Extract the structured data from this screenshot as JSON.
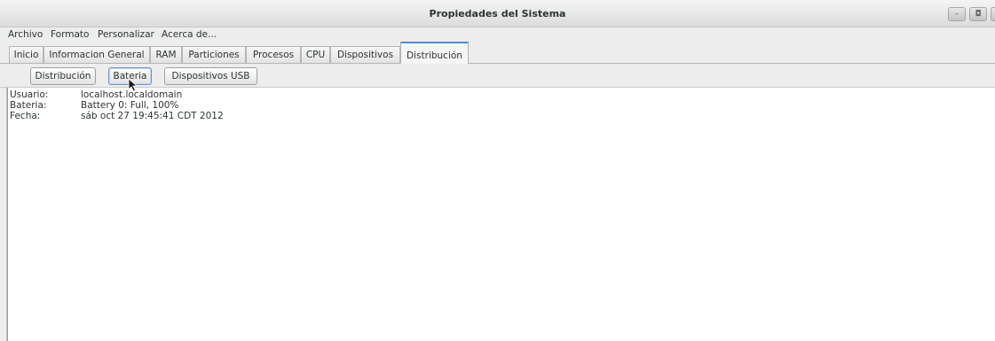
{
  "window": {
    "title": "Propiedades del Sistema",
    "controls": [
      "minimize-icon",
      "maximize-icon",
      "close-icon"
    ]
  },
  "menu": {
    "items": [
      "Archivo",
      "Formato",
      "Personalizar",
      "Acerca de..."
    ]
  },
  "tabs": {
    "items": [
      "Inicio",
      "Informacion General",
      "RAM",
      "Particiones",
      "Procesos",
      "CPU",
      "Dispositivos",
      "Distribución"
    ],
    "active": "Distribución"
  },
  "toolbar": {
    "buttons": [
      "Distribución",
      "Bateria",
      "Dispositivos USB"
    ],
    "focused": "Bateria"
  },
  "info": {
    "rows": [
      {
        "label": "Usuario:",
        "value": "localhost.localdomain"
      },
      {
        "label": "Bateria:",
        "value": "Battery 0: Full, 100%"
      },
      {
        "label": "Fecha:",
        "value": "sáb oct 27 19:45:41 CDT 2012"
      }
    ]
  },
  "colors": {
    "accent": "#4a90d9",
    "background": "#ededed",
    "content_bg": "#ffffff"
  }
}
